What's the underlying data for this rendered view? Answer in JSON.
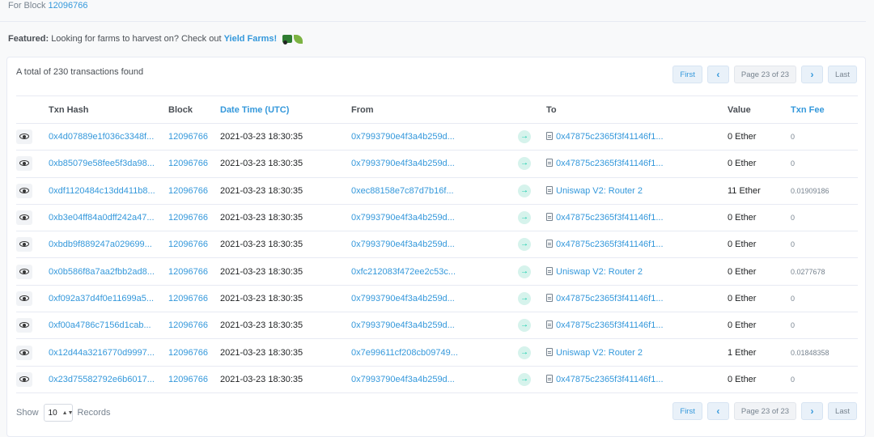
{
  "header": {
    "for_block_label": "For Block",
    "block_number": "12096766"
  },
  "featured": {
    "label": "Featured:",
    "text": "Looking for farms to harvest on? Check out",
    "link": "Yield Farms!",
    "icons": [
      "tractor-icon",
      "leaf-icon"
    ]
  },
  "summary": "A total of 230 transactions found",
  "pagination": {
    "first": "First",
    "prev": "‹",
    "state": "Page 23 of 23",
    "next": "›",
    "last": "Last"
  },
  "columns": [
    "Txn Hash",
    "Block",
    "Date Time (UTC)",
    "From",
    "To",
    "Value",
    "Txn Fee"
  ],
  "rows": [
    {
      "hash": "0x4d07889e1f036c3348f...",
      "block": "12096766",
      "time": "2021-03-23 18:30:35",
      "from": "0x7993790e4f3a4b259d...",
      "to": "0x47875c2365f3f41146f1...",
      "value": "0 Ether",
      "fee": "0"
    },
    {
      "hash": "0xb85079e58fee5f3da98...",
      "block": "12096766",
      "time": "2021-03-23 18:30:35",
      "from": "0x7993790e4f3a4b259d...",
      "to": "0x47875c2365f3f41146f1...",
      "value": "0 Ether",
      "fee": "0"
    },
    {
      "hash": "0xdf1120484c13dd411b8...",
      "block": "12096766",
      "time": "2021-03-23 18:30:35",
      "from": "0xec88158e7c87d7b16f...",
      "to": "Uniswap V2: Router 2",
      "value": "11 Ether",
      "fee": "0.01909186"
    },
    {
      "hash": "0xb3e04ff84a0dff242a47...",
      "block": "12096766",
      "time": "2021-03-23 18:30:35",
      "from": "0x7993790e4f3a4b259d...",
      "to": "0x47875c2365f3f41146f1...",
      "value": "0 Ether",
      "fee": "0"
    },
    {
      "hash": "0xbdb9f889247a029699...",
      "block": "12096766",
      "time": "2021-03-23 18:30:35",
      "from": "0x7993790e4f3a4b259d...",
      "to": "0x47875c2365f3f41146f1...",
      "value": "0 Ether",
      "fee": "0"
    },
    {
      "hash": "0x0b586f8a7aa2fbb2ad8...",
      "block": "12096766",
      "time": "2021-03-23 18:30:35",
      "from": "0xfc212083f472ee2c53c...",
      "to": "Uniswap V2: Router 2",
      "value": "0 Ether",
      "fee": "0.0277678"
    },
    {
      "hash": "0xf092a37d4f0e11699a5...",
      "block": "12096766",
      "time": "2021-03-23 18:30:35",
      "from": "0x7993790e4f3a4b259d...",
      "to": "0x47875c2365f3f41146f1...",
      "value": "0 Ether",
      "fee": "0"
    },
    {
      "hash": "0xf00a4786c7156d1cab...",
      "block": "12096766",
      "time": "2021-03-23 18:30:35",
      "from": "0x7993790e4f3a4b259d...",
      "to": "0x47875c2365f3f41146f1...",
      "value": "0 Ether",
      "fee": "0"
    },
    {
      "hash": "0x12d44a3216770d9997...",
      "block": "12096766",
      "time": "2021-03-23 18:30:35",
      "from": "0x7e99611cf208cb09749...",
      "to": "Uniswap V2: Router 2",
      "value": "1 Ether",
      "fee": "0.01848358"
    },
    {
      "hash": "0x23d75582792e6b6017...",
      "block": "12096766",
      "time": "2021-03-23 18:30:35",
      "from": "0x7993790e4f3a4b259d...",
      "to": "0x47875c2365f3f41146f1...",
      "value": "0 Ether",
      "fee": "0"
    }
  ],
  "direction_symbol": "→",
  "records": {
    "show_label": "Show",
    "value": "10",
    "records_label": "Records"
  },
  "colors": {
    "link": "#3498db",
    "direction": "#00c9a7",
    "border": "#e7eaf3"
  }
}
